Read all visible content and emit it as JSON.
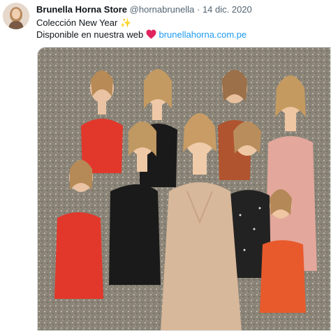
{
  "user": {
    "display_name": "Brunella Horna Store",
    "handle": "@hornabrunella",
    "separator": "·",
    "date": "14 dic. 2020",
    "avatar_icon": "profile-photo"
  },
  "tweet": {
    "line1_text": "Colección New Year",
    "line1_emoji": "✨",
    "line2_text": "Disponible en nuestra web",
    "line2_emoji_icon": "red-heart-icon",
    "link": "brunellahorna.com.pe"
  },
  "media": {
    "description_icon": "collage-photo",
    "background_color": "#8a8478",
    "dress_colors": [
      "#e2382b",
      "#1a1a1a",
      "#d8b89a",
      "#e3a79c",
      "#e85a2c"
    ]
  },
  "colors": {
    "text": "#0f1419",
    "secondary": "#536471",
    "link": "#1d9bf0"
  }
}
